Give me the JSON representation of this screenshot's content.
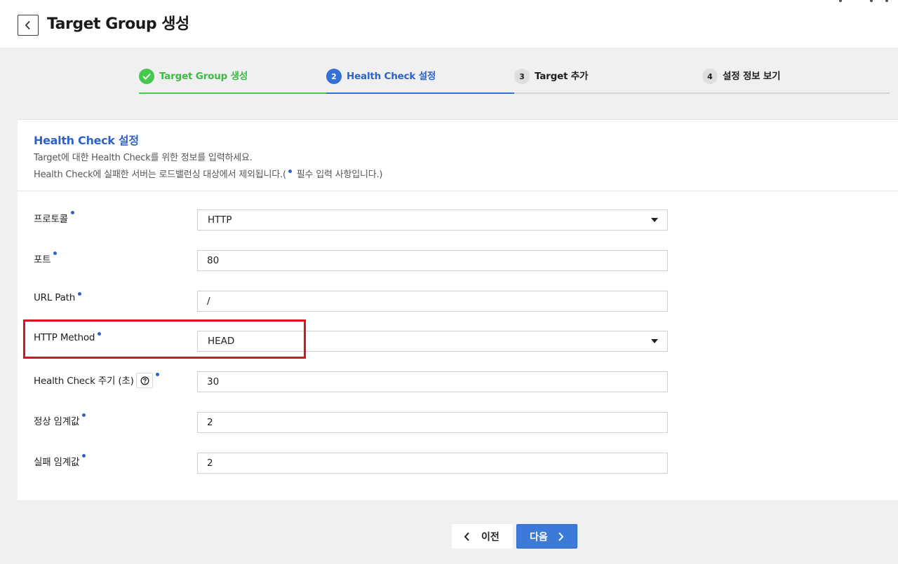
{
  "header": {
    "title": "Target Group 생성"
  },
  "stepper": {
    "steps": [
      {
        "number": "",
        "label": "Target Group 생성",
        "state": "done"
      },
      {
        "number": "2",
        "label": "Health Check 설정",
        "state": "active"
      },
      {
        "number": "3",
        "label": "Target 추가",
        "state": "todo"
      },
      {
        "number": "4",
        "label": "설정 정보 보기",
        "state": "todo"
      }
    ]
  },
  "section": {
    "title": "Health Check 설정",
    "desc1": "Target에 대한 Health Check를 위한 정보를 입력하세요.",
    "desc2_prefix": "Health Check에 실패한 서버는 로드밸런싱 대상에서 제외됩니다.(",
    "desc2_suffix": " 필수 입력 사항입니다.)"
  },
  "form": {
    "protocol": {
      "label": "프로토콜",
      "value": "HTTP"
    },
    "port": {
      "label": "포트",
      "value": "80"
    },
    "url_path": {
      "label": "URL Path",
      "value": "/"
    },
    "http_method": {
      "label": "HTTP Method",
      "value": "HEAD"
    },
    "interval": {
      "label": "Health Check 주기 (초)",
      "value": "30"
    },
    "healthy_threshold": {
      "label": "정상 임계값",
      "value": "2"
    },
    "unhealthy_threshold": {
      "label": "실패 임계값",
      "value": "2"
    }
  },
  "buttons": {
    "prev": "이전",
    "next": "다음"
  },
  "colors": {
    "accent": "#2d63c8",
    "done": "#45c84e",
    "highlight": "#d6151c",
    "primary_button": "#3b7ad9"
  }
}
